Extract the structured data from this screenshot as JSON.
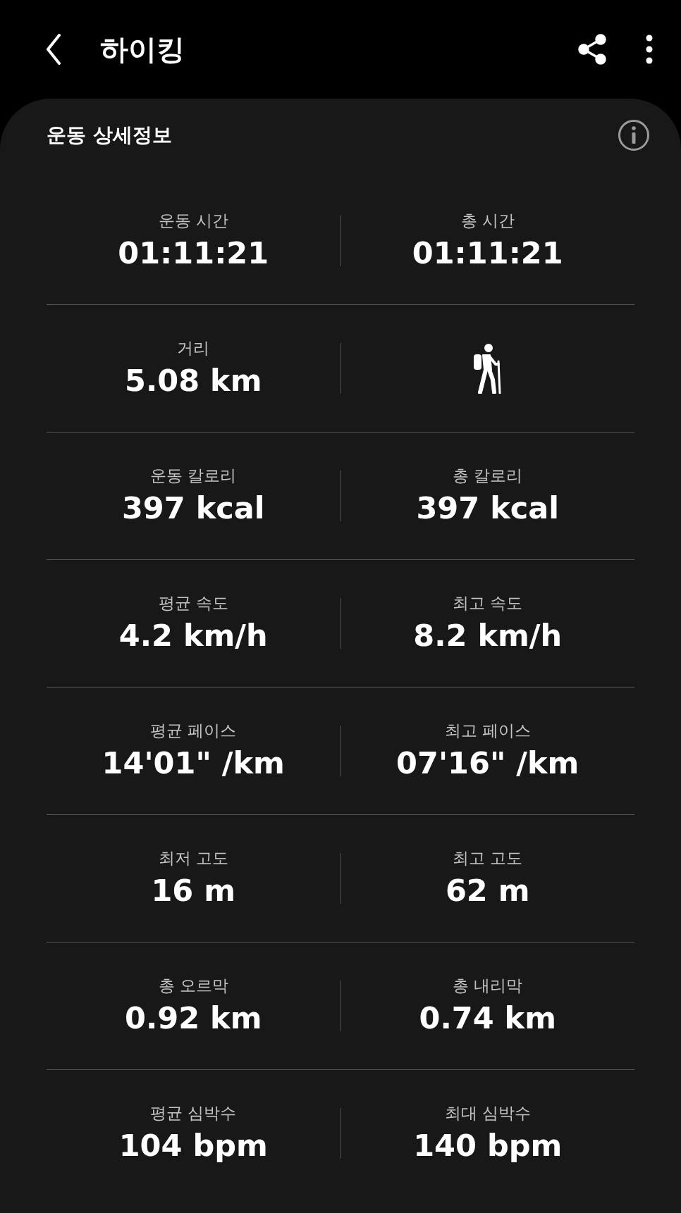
{
  "header": {
    "title": "하이킹"
  },
  "card": {
    "title": "운동 상세정보"
  },
  "rows": [
    [
      {
        "kind": "stat",
        "label": "운동 시간",
        "value": "01:11:21"
      },
      {
        "kind": "stat",
        "label": "총 시간",
        "value": "01:11:21"
      }
    ],
    [
      {
        "kind": "stat",
        "label": "거리",
        "value": "5.08 km"
      },
      {
        "kind": "icon"
      }
    ],
    [
      {
        "kind": "stat",
        "label": "운동 칼로리",
        "value": "397 kcal"
      },
      {
        "kind": "stat",
        "label": "총 칼로리",
        "value": "397 kcal"
      }
    ],
    [
      {
        "kind": "stat",
        "label": "평균 속도",
        "value": "4.2 km/h"
      },
      {
        "kind": "stat",
        "label": "최고 속도",
        "value": "8.2 km/h"
      }
    ],
    [
      {
        "kind": "stat",
        "label": "평균 페이스",
        "value": "14'01\" /km"
      },
      {
        "kind": "stat",
        "label": "최고 페이스",
        "value": "07'16\" /km"
      }
    ],
    [
      {
        "kind": "stat",
        "label": "최저 고도",
        "value": "16 m"
      },
      {
        "kind": "stat",
        "label": "최고 고도",
        "value": "62 m"
      }
    ],
    [
      {
        "kind": "stat",
        "label": "총 오르막",
        "value": "0.92 km"
      },
      {
        "kind": "stat",
        "label": "총 내리막",
        "value": "0.74 km"
      }
    ],
    [
      {
        "kind": "stat",
        "label": "평균 심박수",
        "value": "104 bpm"
      },
      {
        "kind": "stat",
        "label": "최대 심박수",
        "value": "140 bpm"
      }
    ]
  ]
}
